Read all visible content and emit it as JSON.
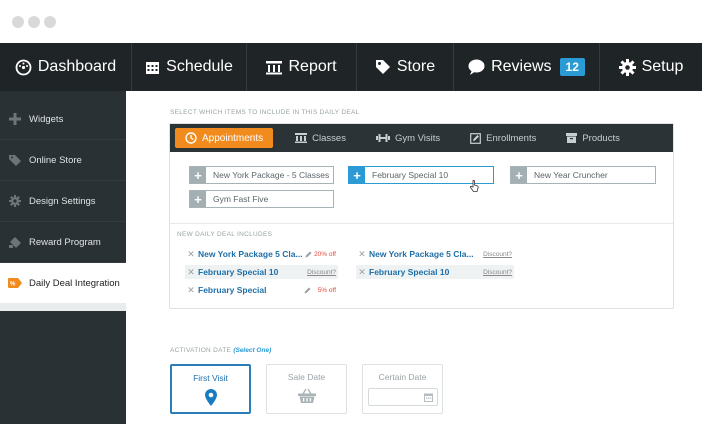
{
  "nav": {
    "items": [
      {
        "label": "Dashboard",
        "icon": "dashboard-gauge-icon"
      },
      {
        "label": "Schedule",
        "icon": "calendar-icon"
      },
      {
        "label": "Report",
        "icon": "bank-report-icon"
      },
      {
        "label": "Store",
        "icon": "tag-icon"
      },
      {
        "label": "Reviews",
        "icon": "speech-bubble-icon",
        "badge": "12"
      },
      {
        "label": "Setup",
        "icon": "gear-icon"
      }
    ]
  },
  "sidebar": {
    "items": [
      {
        "label": "Widgets",
        "icon": "plus-icon"
      },
      {
        "label": "Online Store",
        "icon": "tag-icon"
      },
      {
        "label": "Design Settings",
        "icon": "gear-icon"
      },
      {
        "label": "Reward Program",
        "icon": "gift-icon"
      },
      {
        "label": "Daily Deal Integration",
        "icon": "deal-tag-icon",
        "active": true
      }
    ]
  },
  "main": {
    "select_heading": "SELECT WHICH ITEMS TO INCLUDE IN THIS DAILY DEAL",
    "tabs": [
      {
        "label": "Appointments",
        "icon": "clock-icon",
        "active": true
      },
      {
        "label": "Classes",
        "icon": "building-icon"
      },
      {
        "label": "Gym Visits",
        "icon": "dumbbell-icon"
      },
      {
        "label": "Enrollments",
        "icon": "edit-icon"
      },
      {
        "label": "Products",
        "icon": "box-icon"
      }
    ],
    "items": [
      {
        "label": "New York Package - 5 Classes",
        "selected": false
      },
      {
        "label": "February Special 10",
        "selected": true
      },
      {
        "label": "New Year Cruncher",
        "selected": false
      },
      {
        "label": "Gym Fast Five",
        "selected": false
      }
    ],
    "includes_heading": "NEW DAILY DEAL INCLUDES",
    "deal_left": [
      {
        "name": "New York Package 5 Cla...",
        "note": "20% off",
        "type": "off"
      },
      {
        "name": "February Special 10",
        "note": "Discount?",
        "type": "discount"
      },
      {
        "name": "February Special",
        "note": "5% off",
        "type": "off"
      }
    ],
    "deal_right": [
      {
        "name": "New York Package 5 Cla...",
        "note": "Discount?",
        "type": "discount"
      },
      {
        "name": "February Special 10",
        "note": "Discount?",
        "type": "discount"
      }
    ],
    "activation": {
      "label": "ACTIVATION DATE",
      "hint": "(Select One)",
      "options": [
        {
          "label": "First Visit",
          "icon": "map-pin-icon",
          "active": true
        },
        {
          "label": "Sale Date",
          "icon": "basket-icon"
        },
        {
          "label": "Certain Date",
          "icon": "calendar-icon"
        }
      ]
    }
  },
  "colors": {
    "accent_orange": "#f28b1e",
    "accent_blue": "#2a9bd4",
    "nav_bg": "#1f2426",
    "sidebar_bg": "#2a3134"
  }
}
